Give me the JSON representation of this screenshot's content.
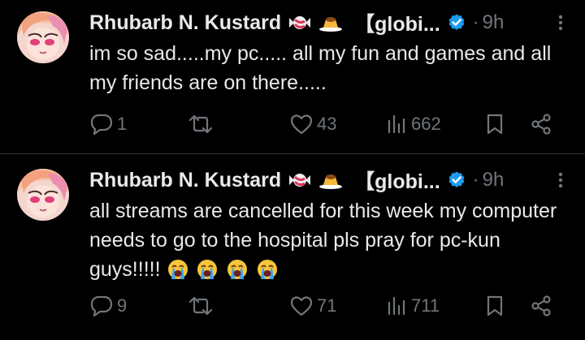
{
  "tweets": [
    {
      "display_name": "Rhubarb N. Kustard",
      "handle_fragment": "【globi...",
      "dot": "·",
      "time": "9h",
      "text": "im so sad.....my pc..... all my fun and games and all my friends are on there.....",
      "replies": "1",
      "reposts": "",
      "likes": "43",
      "views": "662"
    },
    {
      "display_name": "Rhubarb N. Kustard",
      "handle_fragment": "【globi...",
      "dot": "·",
      "time": "9h",
      "text": "all streams are cancelled for this week my computer needs to go to the hospital pls pray for pc-kun guys!!!!!",
      "emoji_names": [
        "loudly-crying-face",
        "loudly-crying-face",
        "loudly-crying-face",
        "loudly-crying-face"
      ],
      "replies": "9",
      "reposts": "",
      "likes": "71",
      "views": "711"
    }
  ],
  "colors": {
    "background": "#000000",
    "text": "#e7e9ea",
    "muted": "#71767b",
    "verified": "#1d9bf0",
    "divider": "#2f3336"
  },
  "icons": [
    "candy-icon",
    "pudding-icon",
    "verified-badge-icon",
    "more-icon",
    "reply-icon",
    "repost-icon",
    "like-icon",
    "views-icon",
    "bookmark-icon",
    "share-icon"
  ]
}
